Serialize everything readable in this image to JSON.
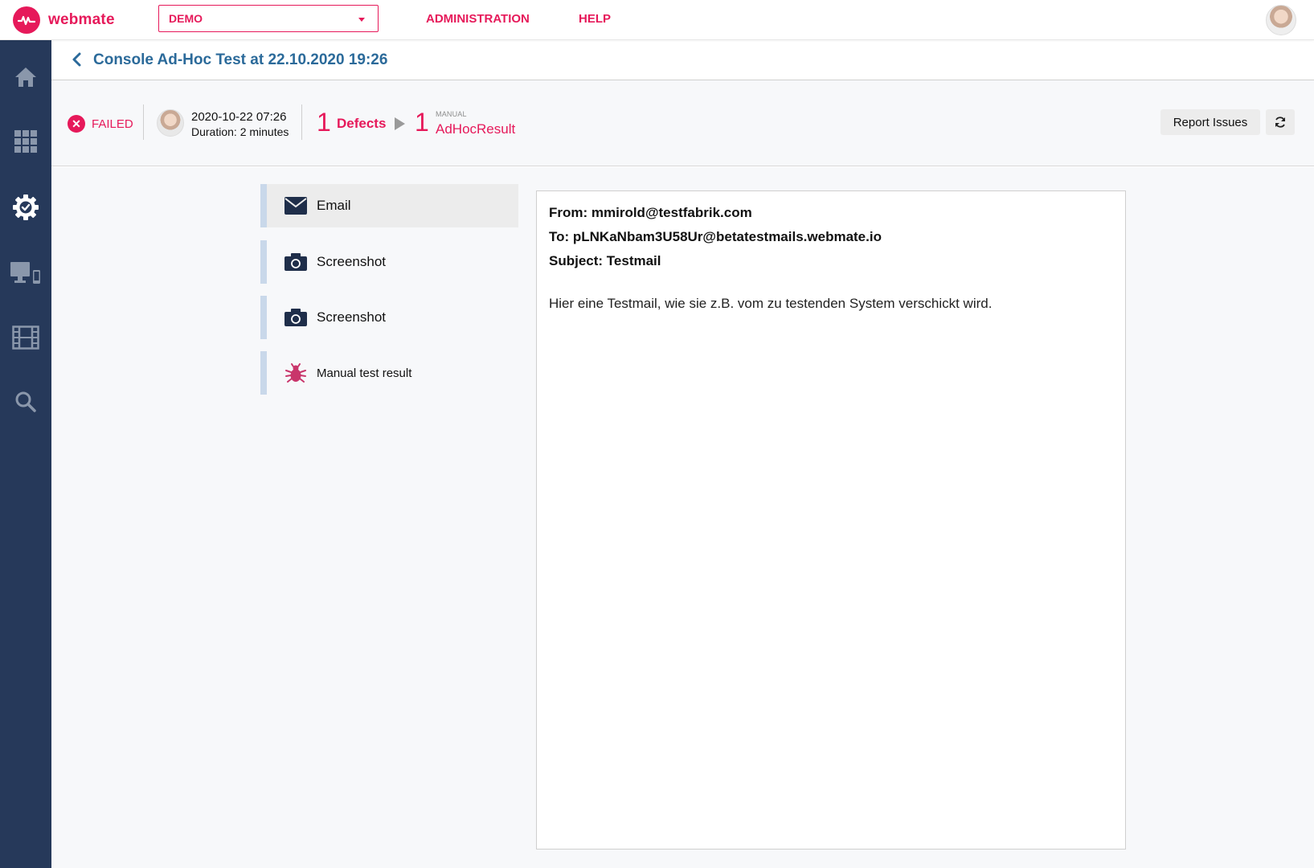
{
  "app": {
    "name": "webmate",
    "brand_color": "#e6195a",
    "sidebar_color": "#26395a"
  },
  "topbar": {
    "project": "DEMO",
    "nav": [
      "ADMINISTRATION",
      "HELP"
    ]
  },
  "sidebar": {
    "items": [
      {
        "icon": "home-icon"
      },
      {
        "icon": "apps-grid-icon"
      },
      {
        "icon": "settings-check-icon",
        "active": true
      },
      {
        "icon": "devices-icon"
      },
      {
        "icon": "film-icon"
      },
      {
        "icon": "search-icon"
      }
    ]
  },
  "breadcrumb": {
    "title": "Console Ad-Hoc Test at 22.10.2020 19:26"
  },
  "status": {
    "state": "FAILED",
    "date": "2020-10-22 07:26",
    "duration": "Duration: 2 minutes",
    "defects_count": "1",
    "defects_label": "Defects",
    "result_count": "1",
    "result_tag": "MANUAL",
    "result_label": "AdHocResult",
    "report_button": "Report Issues"
  },
  "artifacts": [
    {
      "label": "Email",
      "icon": "envelope-icon",
      "active": true
    },
    {
      "label": "Screenshot",
      "icon": "camera-icon"
    },
    {
      "label": "Screenshot",
      "icon": "camera-icon"
    },
    {
      "label": "Manual test result",
      "icon": "bug-icon"
    }
  ],
  "email": {
    "from": "From: mmirold@testfabrik.com",
    "to": "To: pLNKaNbam3U58Ur@betatestmails.webmate.io",
    "subject": "Subject: Testmail",
    "body": "Hier eine Testmail, wie sie z.B. vom zu testenden System verschickt wird."
  }
}
